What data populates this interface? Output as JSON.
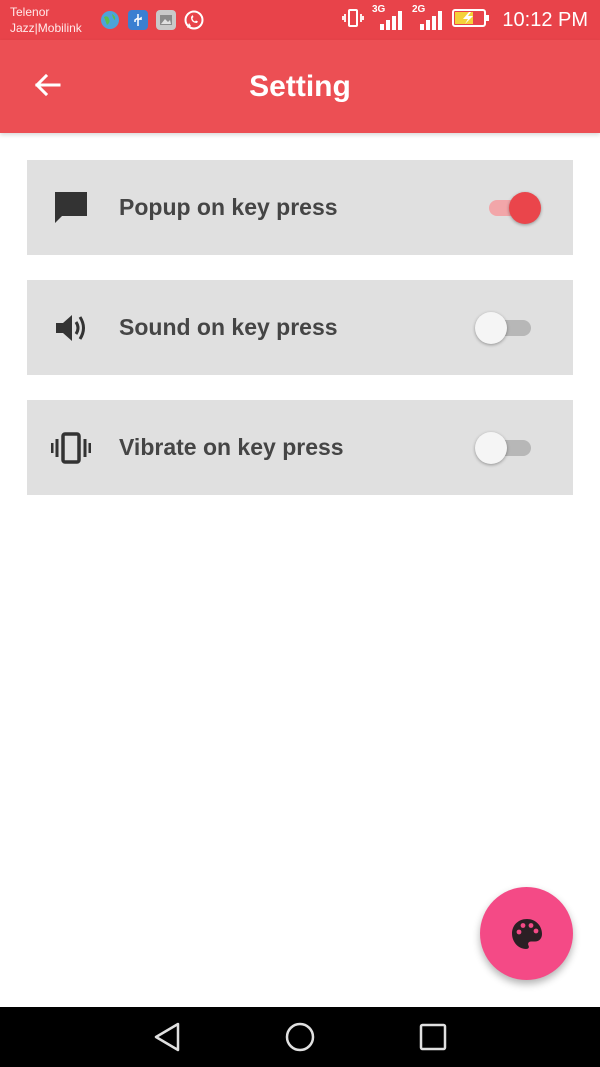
{
  "status_bar": {
    "carrier_1": "Telenor",
    "carrier_2": "Jazz|Mobilink",
    "network_1": "3G",
    "network_2": "2G",
    "time": "10:12 PM"
  },
  "app_bar": {
    "title": "Setting",
    "back_icon": "arrow-back-icon"
  },
  "settings": [
    {
      "label": "Popup on key press",
      "icon": "message-icon",
      "enabled": true
    },
    {
      "label": "Sound on key press",
      "icon": "volume-icon",
      "enabled": false
    },
    {
      "label": "Vibrate on key press",
      "icon": "vibration-icon",
      "enabled": false
    }
  ],
  "fab": {
    "icon": "palette-icon"
  },
  "colors": {
    "primary": "#ec4f54",
    "status_bar": "#e8434a",
    "accent": "#f44a86",
    "row_bg": "#e0e0e0"
  }
}
